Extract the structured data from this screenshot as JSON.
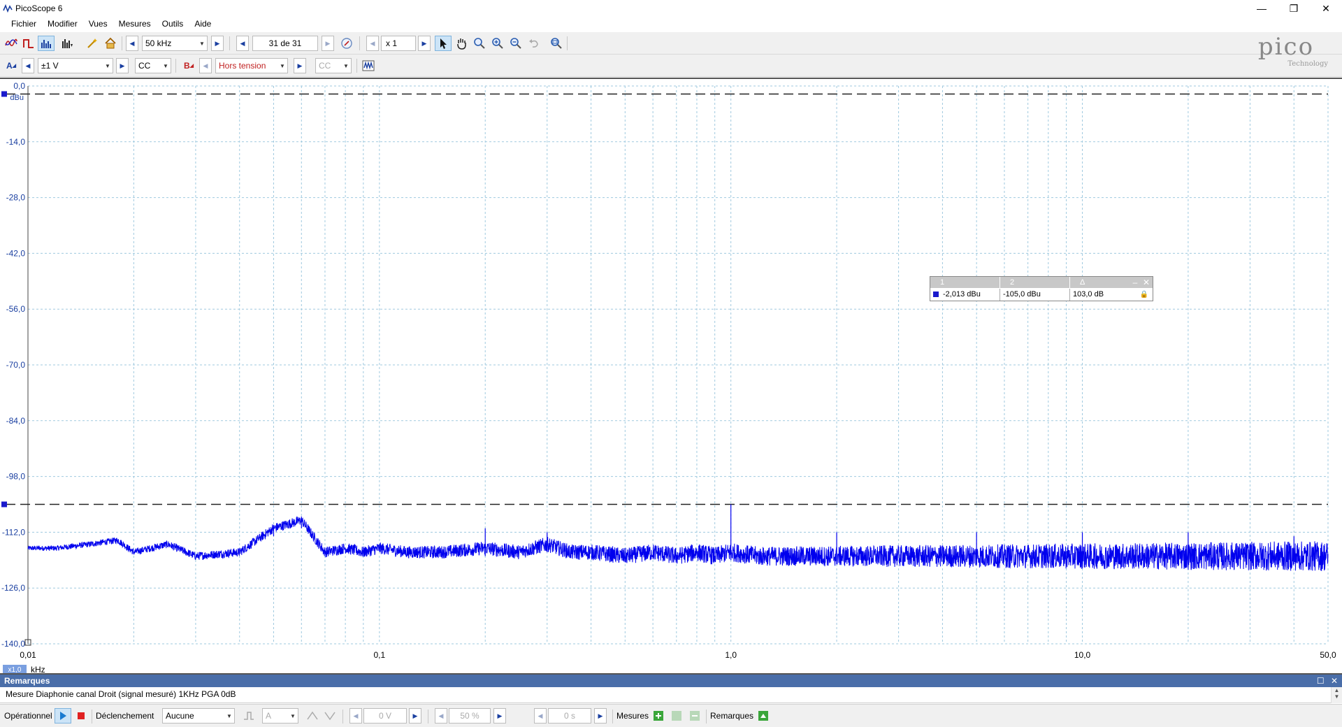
{
  "window": {
    "title": "PicoScope 6"
  },
  "menu": [
    "Fichier",
    "Modifier",
    "Vues",
    "Mesures",
    "Outils",
    "Aide"
  ],
  "toolbar": {
    "timebase": "50 kHz",
    "buffer": "31 de 31",
    "zoom": "x 1"
  },
  "channels": {
    "a_label": "A",
    "a_range": "±1 V",
    "a_coupling": "CC",
    "b_label": "B",
    "b_range": "Hors tension",
    "b_coupling": "CC"
  },
  "logo": {
    "word": "pico",
    "sub": "Technology"
  },
  "plot": {
    "y_unit": "dBu",
    "x_unit": "kHz",
    "x_scale_badge": "x1,0",
    "y_ticks": [
      "0,0",
      "-14,0",
      "-28,0",
      "-42,0",
      "-56,0",
      "-70,0",
      "-84,0",
      "-98,0",
      "-112,0",
      "-126,0",
      "-140,0"
    ],
    "x_ticks": [
      "0,01",
      "0,1",
      "1,0",
      "10,0",
      "50,0"
    ]
  },
  "chart_data": {
    "type": "line",
    "title": "",
    "xlabel": "kHz",
    "ylabel": "dBu",
    "x_scale": "log",
    "xlim": [
      0.01,
      50
    ],
    "ylim": [
      -140,
      0
    ],
    "grid": true,
    "rulers_dbu": [
      -2.013,
      -105.0
    ],
    "series": [
      {
        "color": "#0000ee",
        "x": [
          0.01,
          0.012,
          0.015,
          0.018,
          0.02,
          0.025,
          0.03,
          0.04,
          0.05,
          0.06,
          0.07,
          0.08,
          0.09,
          0.1,
          0.12,
          0.15,
          0.2,
          0.25,
          0.3,
          0.35,
          0.4,
          0.5,
          0.6,
          0.7,
          0.8,
          0.9,
          1.0,
          1.2,
          1.5,
          2.0,
          3.0,
          4.0,
          5.0,
          6.0,
          7.0,
          8.0,
          10.0,
          15.0,
          20.0,
          30.0,
          40.0,
          50.0
        ],
        "values": [
          -116,
          -116,
          -115,
          -114,
          -117,
          -115,
          -118,
          -117,
          -111,
          -109,
          -117,
          -116,
          -117,
          -116,
          -117,
          -117,
          -116,
          -117,
          -115,
          -117,
          -117,
          -118,
          -117,
          -118,
          -117,
          -118,
          -117,
          -118,
          -118,
          -118,
          -118,
          -118,
          -118,
          -118,
          -118,
          -118,
          -118,
          -118,
          -118,
          -118,
          -118,
          -118
        ],
        "spurs": [
          {
            "x": 0.05,
            "y": -111
          },
          {
            "x": 0.06,
            "y": -110
          },
          {
            "x": 0.2,
            "y": -111
          },
          {
            "x": 0.3,
            "y": -112
          },
          {
            "x": 1.0,
            "y": -105
          },
          {
            "x": 2.0,
            "y": -112
          },
          {
            "x": 5.0,
            "y": -112
          },
          {
            "x": 10.0,
            "y": -112
          },
          {
            "x": 20.0,
            "y": -112
          },
          {
            "x": 40.0,
            "y": -113
          }
        ]
      }
    ]
  },
  "measurements": {
    "headers": [
      "1",
      "2",
      "Δ"
    ],
    "values": [
      "-2,013 dBu",
      "-105,0 dBu",
      "103,0 dB"
    ]
  },
  "remarks": {
    "title": "Remarques",
    "text": "Mesure Diaphonie canal Droit (signal mesuré) 1KHz PGA 0dB"
  },
  "status": {
    "operational": "Opérationnel",
    "trigger_label": "Déclenchement",
    "trigger_mode": "Aucune",
    "trigger_source": "A",
    "trigger_level": "0 V",
    "pre_trigger": "50 %",
    "delay": "0 s",
    "measures_label": "Mesures",
    "remarks_label": "Remarques"
  }
}
